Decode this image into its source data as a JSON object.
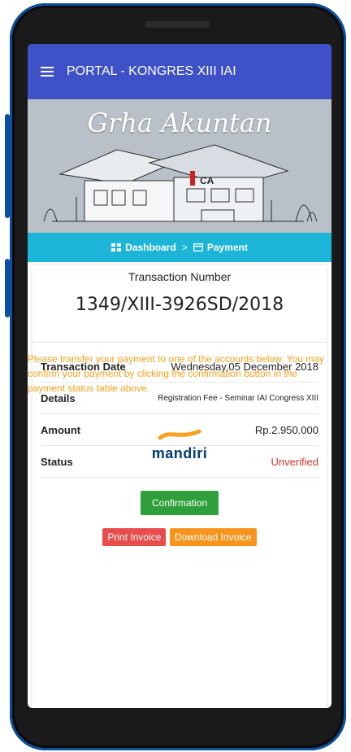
{
  "appbar": {
    "title": "PORTAL - KONGRES XIII IAI"
  },
  "banner": {
    "title": "Grha Akuntan"
  },
  "breadcrumb": {
    "dashboard": "Dashboard",
    "separator": ">",
    "payment": "Payment"
  },
  "transaction": {
    "label": "Transaction Number",
    "number": "1349/XIII-3926SD/2018"
  },
  "rows": [
    {
      "key": "Transaction Date",
      "value": "Wednesday,05 December 2018"
    },
    {
      "key": "Details",
      "value": "Registration Fee - Seminar IAI Congress XIII"
    },
    {
      "key": "Amount",
      "value": "Rp.2.950.000"
    },
    {
      "key": "Status",
      "value": "Unverified"
    }
  ],
  "buttons": {
    "confirmation": "Confirmation",
    "print_invoice": "Print Invoice",
    "download_invoice": "Download Invoice"
  },
  "notice": "Please transfer your payment to one of the accounts below. You may confirm your payment by clicking the confirmation button in the payment status table above.",
  "bank_logo": "mandiri",
  "colors": {
    "appbar": "#3e51c6",
    "breadcrumb": "#1cb5d7",
    "confirm": "#2e9f3a",
    "print": "#e84c4c",
    "download": "#f7941d",
    "status_unverified": "#d9352b",
    "notice": "#f7a11d"
  }
}
